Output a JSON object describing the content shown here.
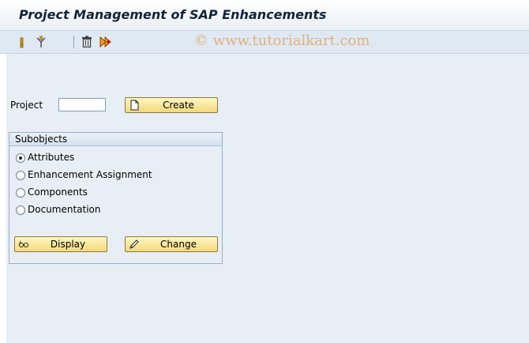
{
  "window": {
    "title": "Project Management of SAP Enhancements"
  },
  "watermark": "© www.tutorialkart.com",
  "toolbar": {
    "icons": [
      "activate-icon",
      "deactivate-icon",
      "delete-icon",
      "check-icon"
    ]
  },
  "form": {
    "project_label": "Project",
    "project_value": "",
    "create_label": "Create"
  },
  "subobjects": {
    "title": "Subobjects",
    "options": [
      {
        "label": "Attributes",
        "selected": true
      },
      {
        "label": "Enhancement Assignment",
        "selected": false
      },
      {
        "label": "Components",
        "selected": false
      },
      {
        "label": "Documentation",
        "selected": false
      }
    ],
    "display_label": "Display",
    "change_label": "Change"
  },
  "colors": {
    "button_fill": "#f3d97b",
    "button_border": "#8c7a3f",
    "content_bg": "#e8eef5",
    "watermark": "#e3b07b"
  }
}
